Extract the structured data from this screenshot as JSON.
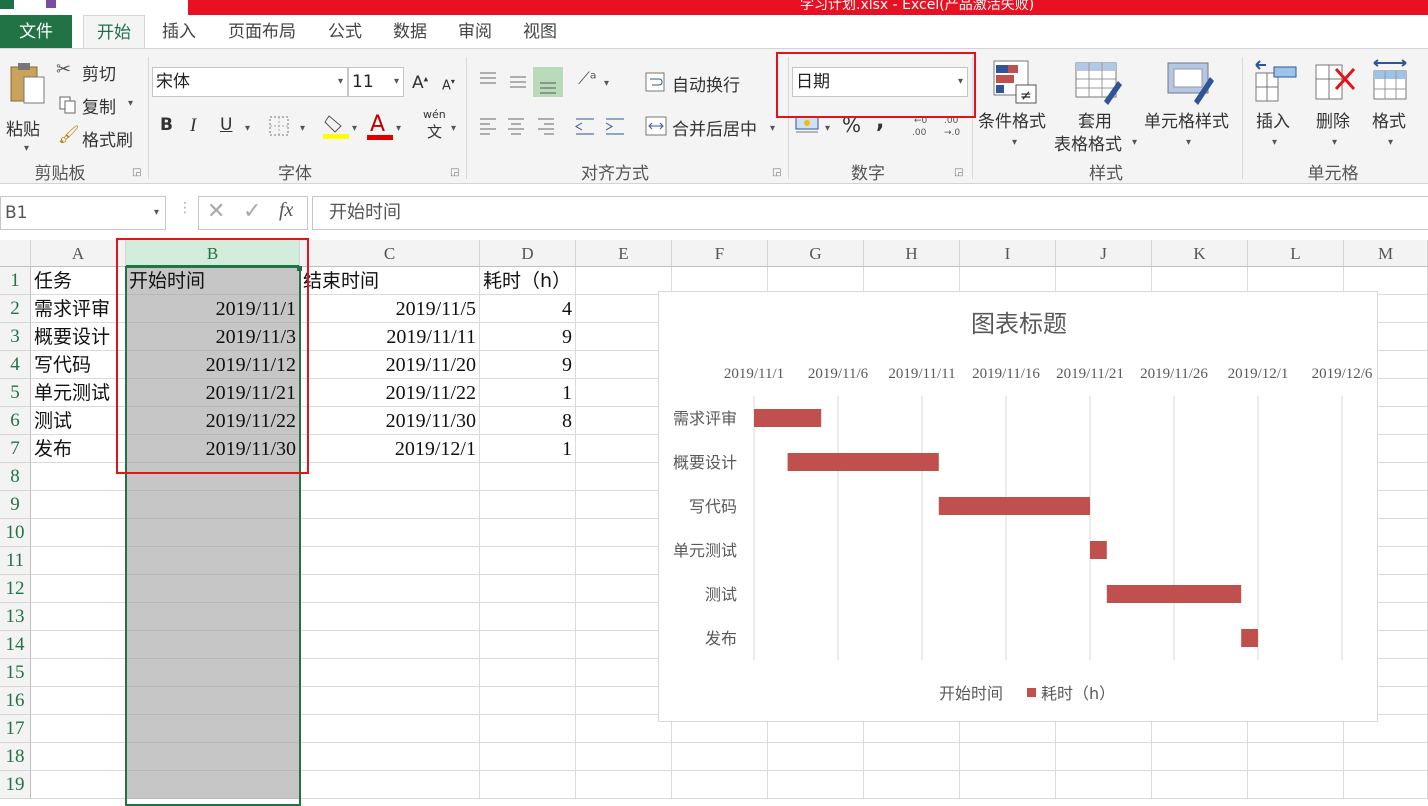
{
  "window": {
    "title": "学习计划.xlsx - Excel(产品激活失败)"
  },
  "tabs": [
    "文件",
    "开始",
    "插入",
    "页面布局",
    "公式",
    "数据",
    "审阅",
    "视图"
  ],
  "active_tab": "开始",
  "ribbon": {
    "clipboard": {
      "paste": "粘贴",
      "cut": "剪切",
      "copy": "复制",
      "format_painter": "格式刷",
      "label": "剪贴板"
    },
    "font": {
      "name": "宋体",
      "size": "11",
      "bold": "B",
      "italic": "I",
      "underline": "U",
      "wen": "wén",
      "wen_char": "文",
      "label": "字体"
    },
    "alignment": {
      "wrap": "自动换行",
      "merge": "合并后居中",
      "label": "对齐方式"
    },
    "number": {
      "format": "日期",
      "percent": "%",
      "comma": ",",
      "label": "数字"
    },
    "styles": {
      "conditional": "条件格式",
      "table_line1": "套用",
      "table_line2": "表格格式",
      "cell_styles": "单元格样式",
      "label": "样式"
    },
    "cells": {
      "insert": "插入",
      "delete": "删除",
      "format": "格式",
      "label": "单元格"
    }
  },
  "formula_bar": {
    "name_box": "B1",
    "fx": "fx",
    "content": "开始时间"
  },
  "columns": [
    "A",
    "B",
    "C",
    "D",
    "E",
    "F",
    "G",
    "H",
    "I",
    "J",
    "K",
    "L",
    "M"
  ],
  "rows": [
    {
      "n": "1",
      "a": "任务",
      "b": "开始时间",
      "c": "结束时间",
      "d": "耗时（h）"
    },
    {
      "n": "2",
      "a": "需求评审",
      "b": "2019/11/1",
      "c": "2019/11/5",
      "d": "4"
    },
    {
      "n": "3",
      "a": "概要设计",
      "b": "2019/11/3",
      "c": "2019/11/11",
      "d": "9"
    },
    {
      "n": "4",
      "a": "写代码",
      "b": "2019/11/12",
      "c": "2019/11/20",
      "d": "9"
    },
    {
      "n": "5",
      "a": "单元测试",
      "b": "2019/11/21",
      "c": "2019/11/22",
      "d": "1"
    },
    {
      "n": "6",
      "a": "测试",
      "b": "2019/11/22",
      "c": "2019/11/30",
      "d": "8"
    },
    {
      "n": "7",
      "a": "发布",
      "b": "2019/11/30",
      "c": "2019/12/1",
      "d": "1"
    },
    {
      "n": "8"
    },
    {
      "n": "9"
    },
    {
      "n": "10"
    },
    {
      "n": "11"
    },
    {
      "n": "12"
    },
    {
      "n": "13"
    },
    {
      "n": "14"
    },
    {
      "n": "15"
    },
    {
      "n": "16"
    },
    {
      "n": "17"
    },
    {
      "n": "18"
    },
    {
      "n": "19"
    }
  ],
  "chart_data": {
    "type": "bar",
    "orientation": "horizontal",
    "stacked": true,
    "title": "图表标题",
    "categories": [
      "需求评审",
      "概要设计",
      "写代码",
      "单元测试",
      "测试",
      "发布"
    ],
    "series": [
      {
        "name": "开始时间",
        "values": [
          "2019-11-01",
          "2019-11-03",
          "2019-11-12",
          "2019-11-21",
          "2019-11-22",
          "2019-11-30"
        ],
        "visible": false
      },
      {
        "name": "耗时（h）",
        "values": [
          4,
          9,
          9,
          1,
          8,
          1
        ],
        "color": "#c0504d"
      }
    ],
    "x_axis_position": "top",
    "x_ticks": [
      "2019/11/1",
      "2019/11/6",
      "2019/11/11",
      "2019/11/16",
      "2019/11/21",
      "2019/11/26",
      "2019/12/1",
      "2019/12/6"
    ],
    "xlim": [
      "2019-11-01",
      "2019-12-06"
    ],
    "grid": true,
    "legend": "bottom"
  },
  "colors": {
    "accent": "#217346",
    "highlight": "#e2141b",
    "bar": "#c0504d",
    "selection": "#c6c6c6"
  }
}
